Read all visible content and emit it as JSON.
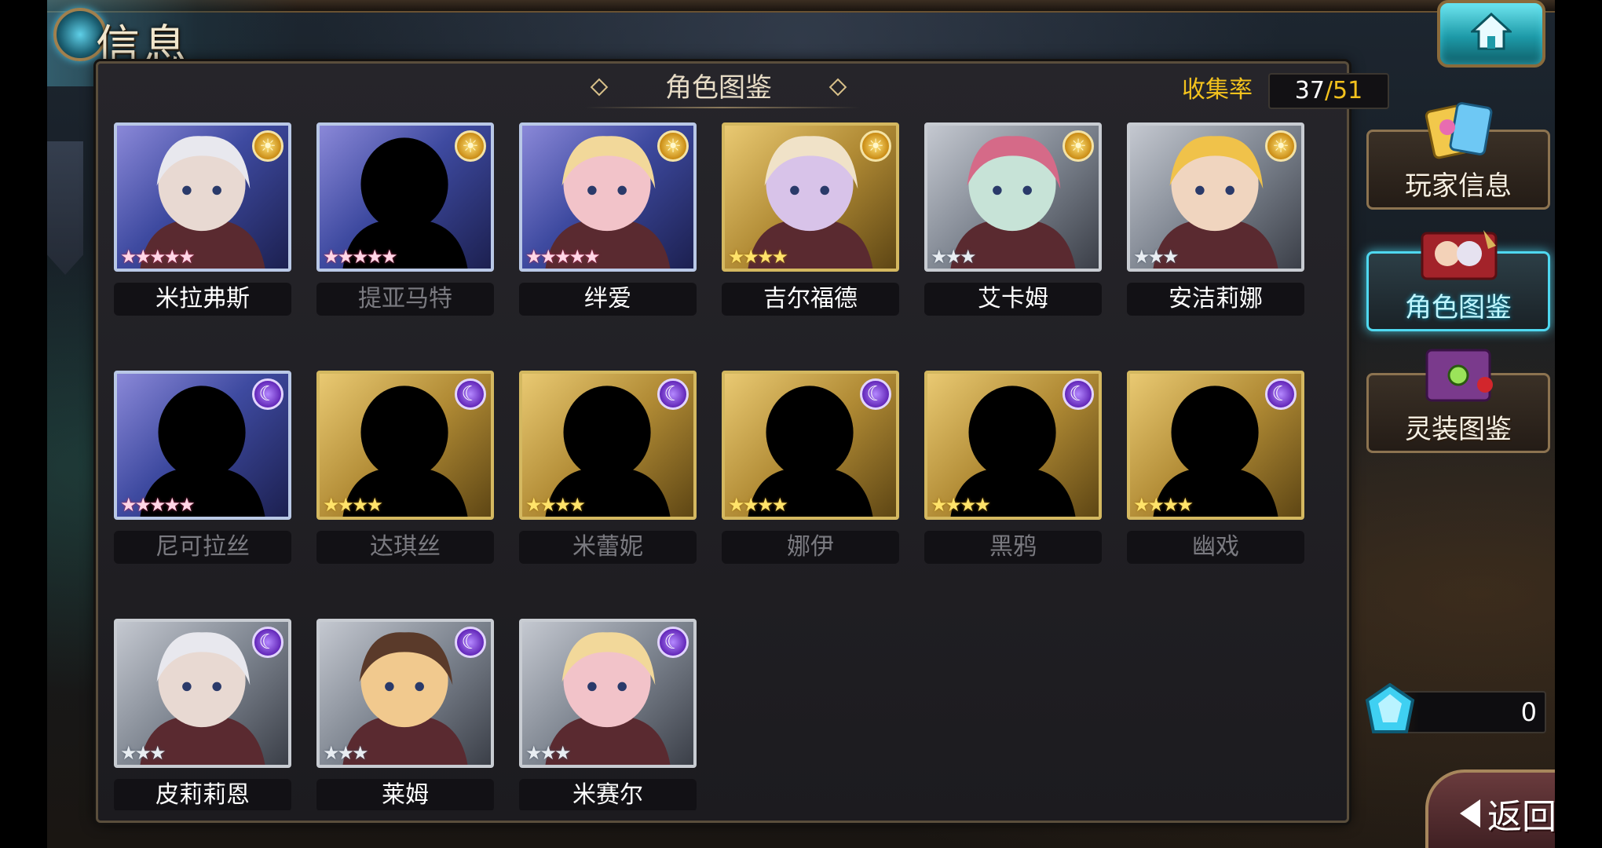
{
  "header": {
    "title": "信息",
    "home_icon": "home-icon"
  },
  "panel": {
    "title": "角色图鉴",
    "collect_label": "收集率",
    "collect_count": "37",
    "collect_sep": "/",
    "collect_total": "51"
  },
  "characters": [
    {
      "name": "米拉弗斯",
      "element": "sun",
      "rarity": 5,
      "frame": "blue",
      "owned": true
    },
    {
      "name": "提亚马特",
      "element": "sun",
      "rarity": 5,
      "frame": "blue",
      "owned": false
    },
    {
      "name": "绊爱",
      "element": "sun",
      "rarity": 5,
      "frame": "blue",
      "owned": true
    },
    {
      "name": "吉尔福德",
      "element": "sun",
      "rarity": 4,
      "frame": "gold",
      "owned": true
    },
    {
      "name": "艾卡姆",
      "element": "sun",
      "rarity": 3,
      "frame": "silver",
      "owned": true
    },
    {
      "name": "安洁莉娜",
      "element": "sun",
      "rarity": 3,
      "frame": "silver",
      "owned": true
    },
    {
      "name": "尼可拉丝",
      "element": "moon",
      "rarity": 5,
      "frame": "blue",
      "owned": false
    },
    {
      "name": "达琪丝",
      "element": "moon",
      "rarity": 4,
      "frame": "gold",
      "owned": false
    },
    {
      "name": "米蕾妮",
      "element": "moon",
      "rarity": 4,
      "frame": "gold",
      "owned": false
    },
    {
      "name": "娜伊",
      "element": "moon",
      "rarity": 4,
      "frame": "gold",
      "owned": false
    },
    {
      "name": "黑鸦",
      "element": "moon",
      "rarity": 4,
      "frame": "gold",
      "owned": false
    },
    {
      "name": "幽戏",
      "element": "moon",
      "rarity": 4,
      "frame": "gold",
      "owned": false
    },
    {
      "name": "皮莉莉恩",
      "element": "moon",
      "rarity": 3,
      "frame": "silver",
      "owned": true
    },
    {
      "name": "莱姆",
      "element": "moon",
      "rarity": 3,
      "frame": "silver",
      "owned": true
    },
    {
      "name": "米赛尔",
      "element": "moon",
      "rarity": 3,
      "frame": "silver",
      "owned": true
    }
  ],
  "side_menu": {
    "player_info": "玩家信息",
    "character_codex": "角色图鉴",
    "equipment_codex": "灵装图鉴"
  },
  "currency": {
    "value": "0",
    "icon": "crystal-gem-icon"
  },
  "back_button": {
    "label": "返回"
  }
}
